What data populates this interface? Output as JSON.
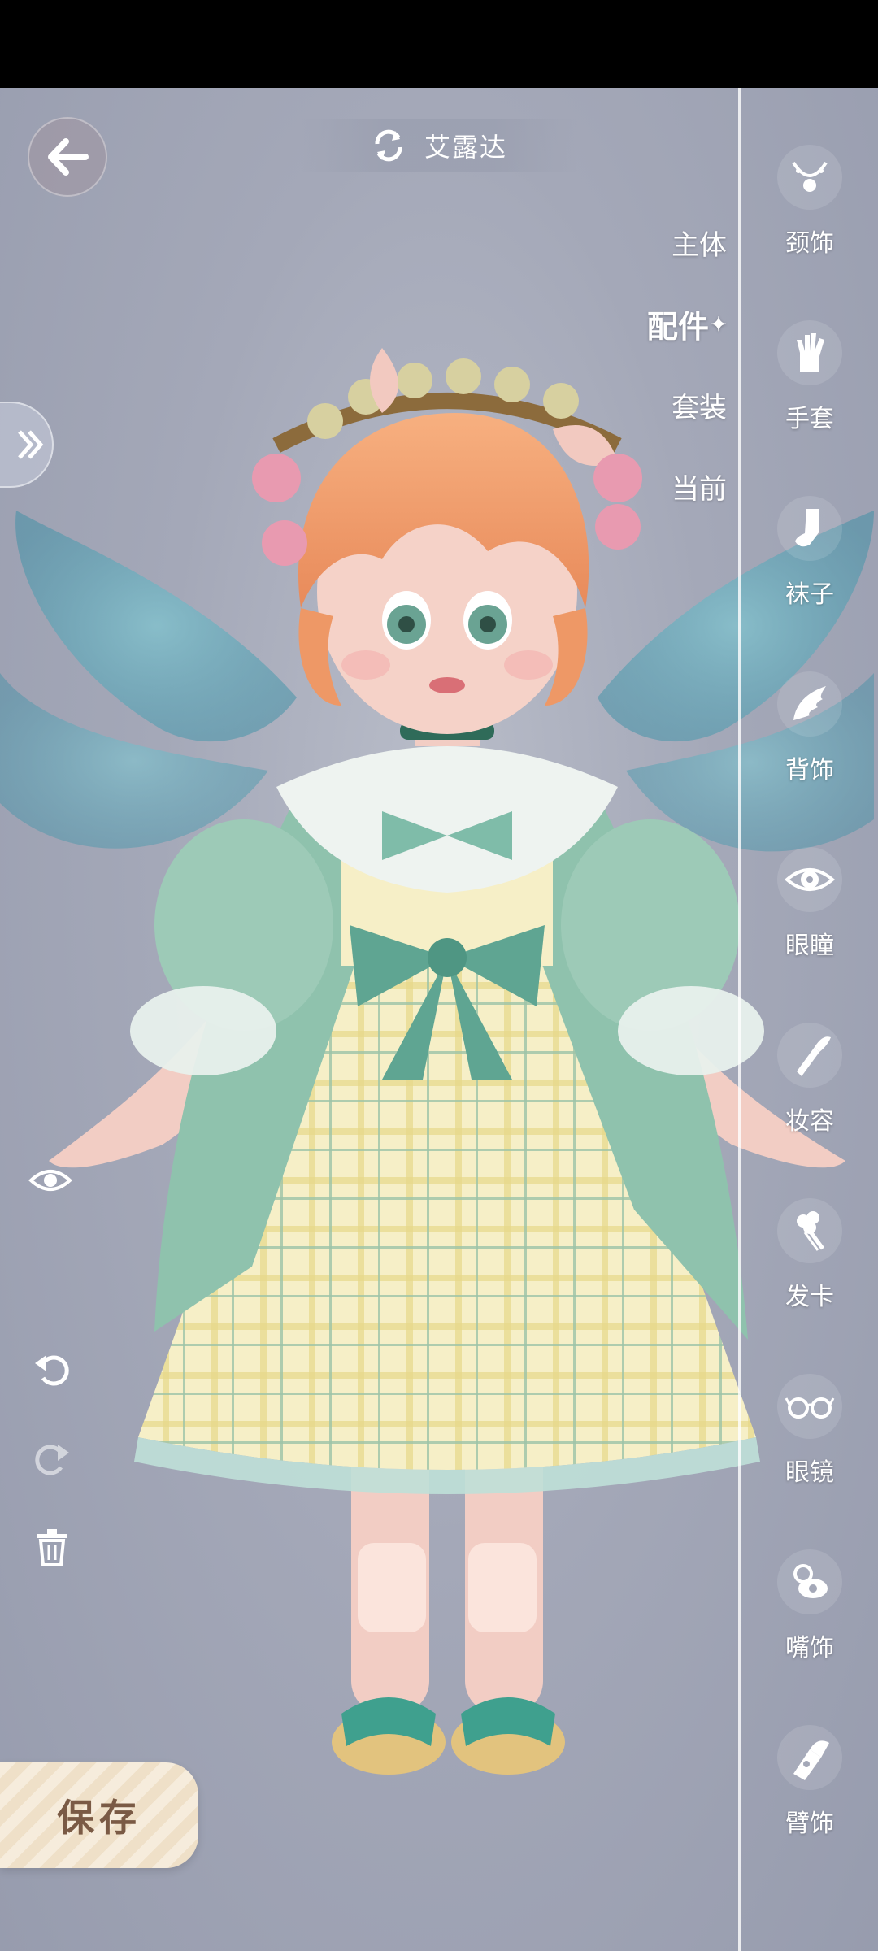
{
  "character": {
    "name": "艾露达"
  },
  "tabs": [
    {
      "label": "主体",
      "active": false
    },
    {
      "label": "配件",
      "active": true
    },
    {
      "label": "套装",
      "active": false
    },
    {
      "label": "当前",
      "active": false
    }
  ],
  "sidebar": {
    "items": [
      {
        "label": "颈饰",
        "icon": "necklace-icon"
      },
      {
        "label": "手套",
        "icon": "glove-icon"
      },
      {
        "label": "袜子",
        "icon": "sock-icon"
      },
      {
        "label": "背饰",
        "icon": "wing-icon"
      },
      {
        "label": "眼瞳",
        "icon": "eye-icon"
      },
      {
        "label": "妆容",
        "icon": "makeup-brush-icon"
      },
      {
        "label": "发卡",
        "icon": "hairclip-icon"
      },
      {
        "label": "眼镜",
        "icon": "glasses-icon"
      },
      {
        "label": "嘴饰",
        "icon": "pacifier-icon"
      },
      {
        "label": "臂饰",
        "icon": "arm-accessory-icon"
      }
    ]
  },
  "actions": {
    "save_label": "保存"
  },
  "colors": {
    "background": "#a4a8b8",
    "dress_green": "#8fc2ad",
    "plaid_yellow": "#f3e9b8",
    "hair": "#f1a06e"
  }
}
